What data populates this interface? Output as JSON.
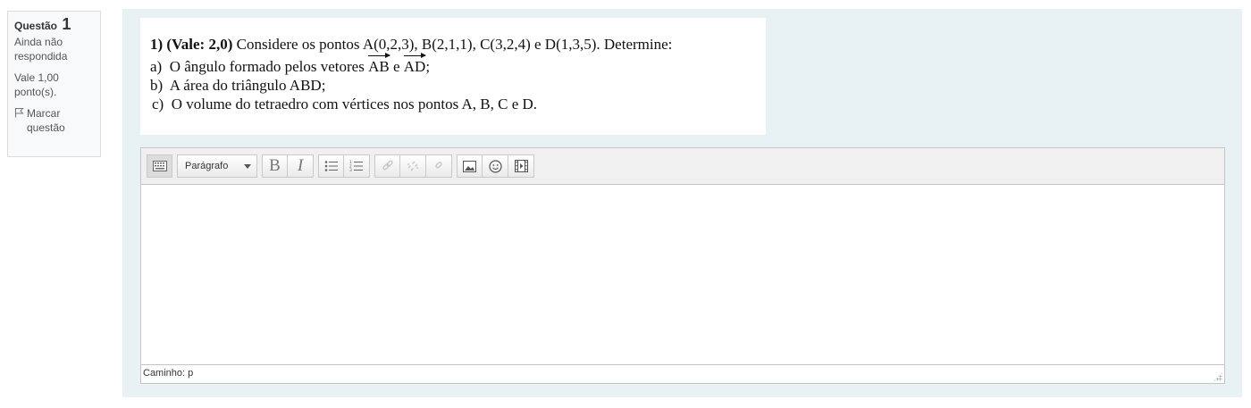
{
  "question_info": {
    "label": "Questão",
    "number": "1",
    "state": "Ainda não respondida",
    "grade": "Vale 1,00 ponto(s).",
    "flag_label": "Marcar questão"
  },
  "question": {
    "intro_bold": "1) (Vale: 2,0)",
    "intro_text": " Considere os pontos A(0,2,3), B(2,1,1), C(3,2,4) e D(1,3,5). Determine:",
    "item_a_prefix": "a)  O ângulo formado pelos vetores ",
    "vector_1": "AB",
    "item_a_mid": " e ",
    "vector_2": "AD",
    "item_a_suffix": ";",
    "item_b": "b)  A área do triângulo ABD;",
    "item_c": "c)  O volume do tetraedro com vértices nos pontos A, B, C e D."
  },
  "editor": {
    "format_select": "Parágrafo",
    "bold_label": "B",
    "italic_label": "I",
    "path_label": "Caminho: p"
  }
}
